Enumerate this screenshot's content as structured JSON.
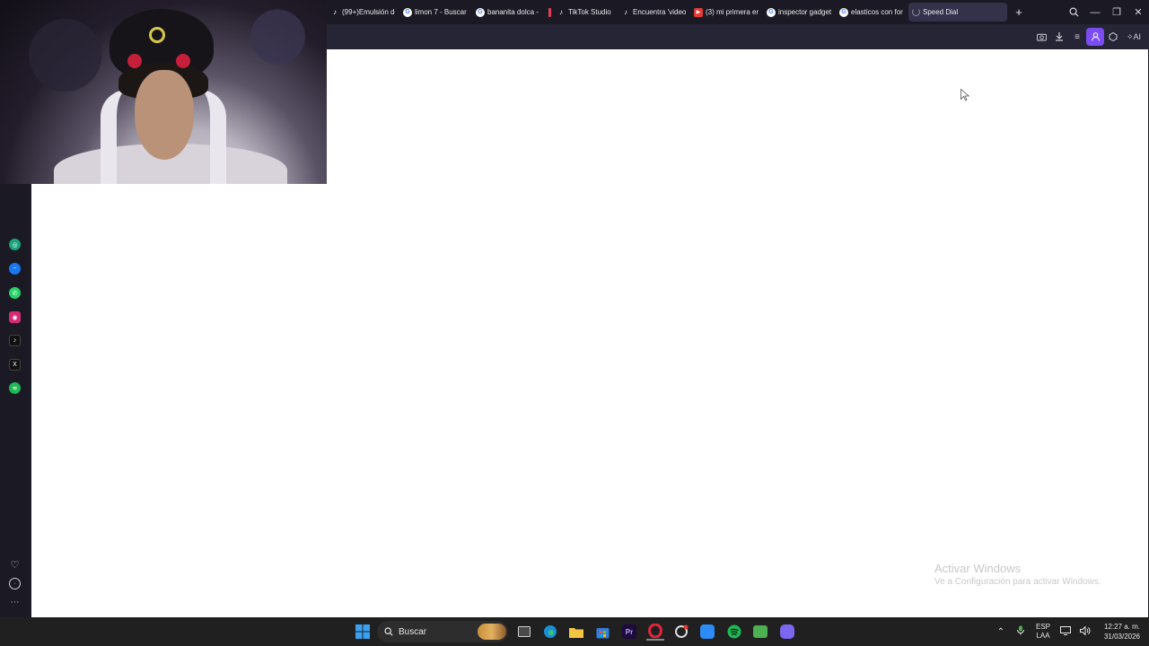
{
  "browser": {
    "tabs": [
      {
        "icon": "tiktok-icon",
        "title": "(99+)Emulsión de"
      },
      {
        "icon": "google-icon",
        "title": "limon 7 - Buscar"
      },
      {
        "icon": "google-icon",
        "title": "bananita dolca -"
      },
      {
        "icon": "tiktok-studio-icon",
        "title": "TikTok Studio"
      },
      {
        "icon": "tiktok-icon",
        "title": "Encuentra 'video"
      },
      {
        "icon": "youtube-icon",
        "title": "(3) mi primera en"
      },
      {
        "icon": "google-icon",
        "title": "inspector gadget"
      },
      {
        "icon": "google-icon",
        "title": "elasticos con for"
      },
      {
        "icon": "loading-spinner-icon",
        "title": "Speed Dial",
        "active": true
      }
    ],
    "toolbar": {
      "ai_label": "AI"
    }
  },
  "sidebar": {
    "apps": [
      "chatgpt-icon",
      "messenger-icon",
      "whatsapp-icon",
      "instagram-icon",
      "tiktok-icon",
      "x-icon",
      "spotify-icon"
    ],
    "bottom": [
      "heart-icon",
      "history-icon",
      "more-icon"
    ]
  },
  "watermark": {
    "line1": "Activar Windows",
    "line2": "Ve a Configuración para activar Windows."
  },
  "taskbar": {
    "search_label": "Buscar",
    "language": "ESP",
    "region": "LAA",
    "time": "12:27 a. m.",
    "date": "31/03/2026"
  },
  "colors": {
    "browser_bg": "#1b1a24",
    "toolbar_bg": "#262535",
    "accent": "#7a4cf2",
    "taskbar_bg": "#202020"
  }
}
